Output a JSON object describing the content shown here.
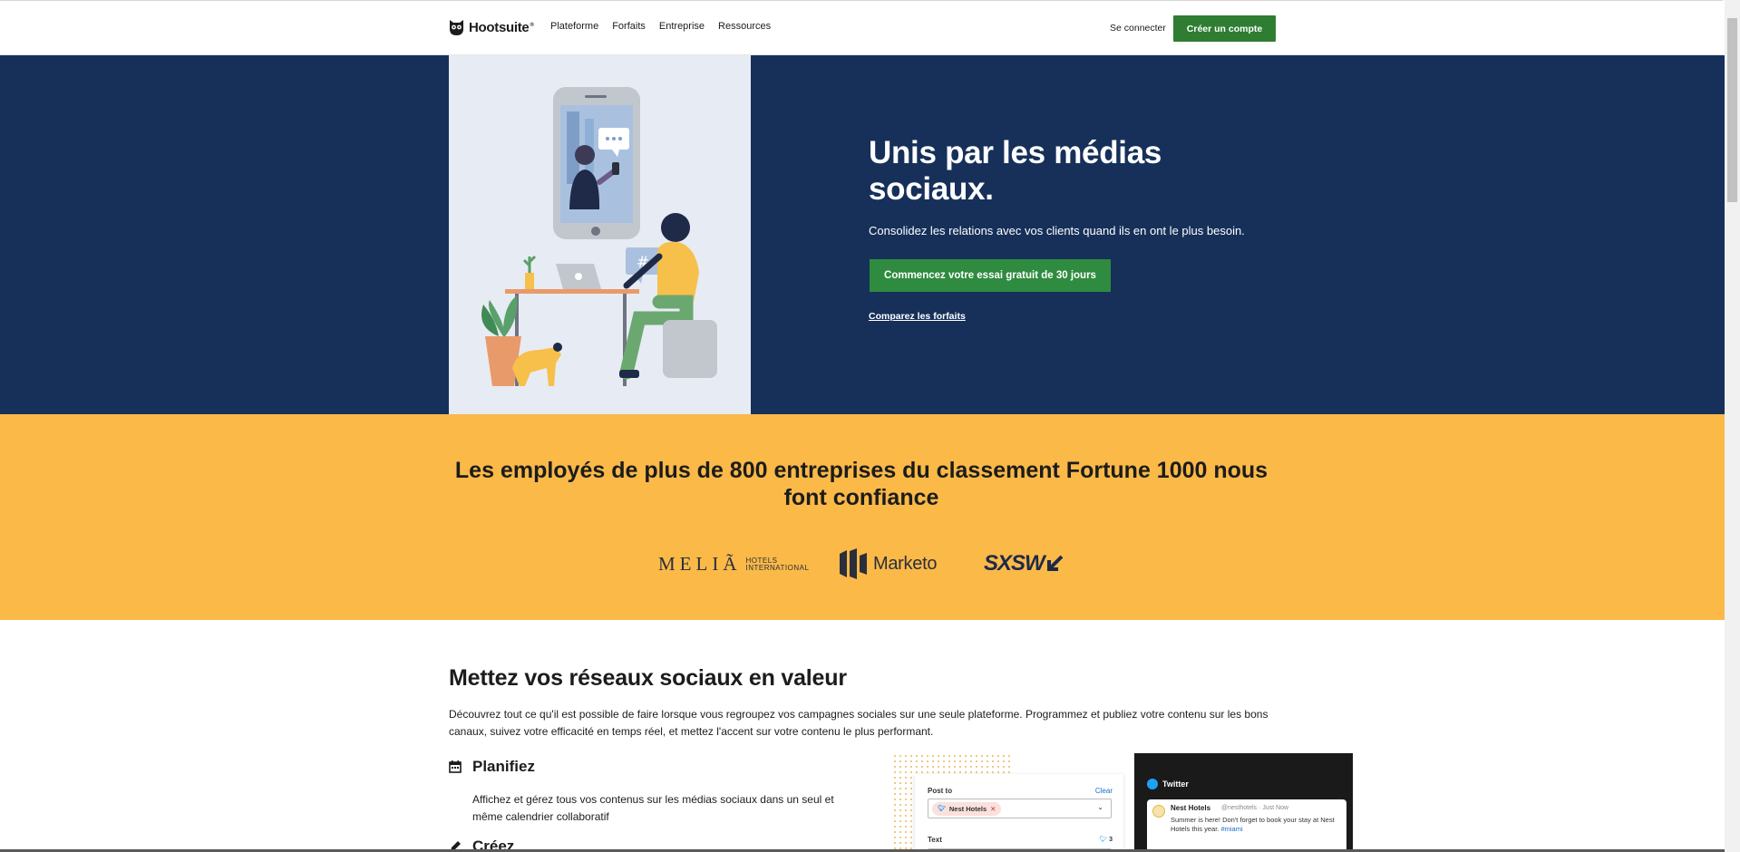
{
  "header": {
    "brand": "Hootsuite",
    "brand_mark": "®",
    "nav": [
      "Plateforme",
      "Forfaits",
      "Entreprise",
      "Ressources"
    ],
    "login": "Se connecter",
    "cta": "Créer un compte"
  },
  "hero": {
    "title": "Unis par les médias sociaux.",
    "subtitle": "Consolidez les relations avec vos clients quand ils en ont le plus besoin.",
    "cta": "Commencez votre essai gratuit de 30 jours",
    "link": "Comparez les forfaits",
    "illustration_text": "#"
  },
  "trust": {
    "title": "Les employés de plus de 800 entreprises du classement Fortune 1000 nous font confiance",
    "logos": {
      "melia": "MELIÃ",
      "melia_sub1": "HOTELS",
      "melia_sub2": "INTERNATIONAL",
      "marketo": "Marketo",
      "sxsw": "SXSW"
    }
  },
  "features": {
    "title": "Mettez vos réseaux sociaux en valeur",
    "description": "Découvrez tout ce qu'il est possible de faire lorsque vous regroupez vos campagnes sociales sur une seule plateforme. Programmez et publiez votre contenu sur les bons canaux, suivez votre efficacité en temps réel, et mettez l'accent sur votre contenu le plus performant.",
    "item1_title": "Planifiez",
    "item1_desc": "Affichez et gérez tous vos contenus sur les médias sociaux dans un seul et même calendrier collaboratif",
    "item2_title": "Créez",
    "mock": {
      "post_to": "Post to",
      "clear": "Clear",
      "chip": "Nest Hotels",
      "text_label": "Text",
      "count": "3",
      "network": "Twitter",
      "card_name": "Nest Hotels",
      "card_handle": "@nesthotels · Just Now",
      "card_text": "Summer is here! Don't forget to book your stay at Nest Hotels this year.",
      "card_tag": "#miami"
    }
  },
  "colors": {
    "navy": "#163059",
    "green": "#2e7d32",
    "yellow": "#fbb948"
  }
}
